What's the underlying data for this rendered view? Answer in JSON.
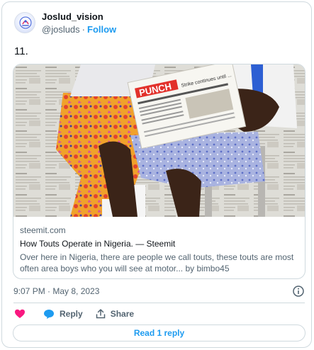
{
  "author": {
    "display_name": "Joslud_vision",
    "handle": "@josluds",
    "separator": "·",
    "follow_label": "Follow"
  },
  "tweet": {
    "text": "11."
  },
  "link_card": {
    "domain": "steemit.com",
    "title": "How Touts Operate in Nigeria. — Steemit",
    "description": "Over here in Nigeria, there are people we call touts, these touts are most often area boys who you will see at motor... by bimbo45",
    "image_alt_icon": "newspaper-reader-photo",
    "image_newspaper_masthead": "PUNCH",
    "image_newspaper_headline": "Strike continues until ..."
  },
  "meta": {
    "timestamp": "9:07 PM · May 8, 2023",
    "info_icon": "info-icon"
  },
  "actions": {
    "like_icon": "heart-icon",
    "reply_label": "Reply",
    "reply_icon": "reply-bubble-icon",
    "share_label": "Share",
    "share_icon": "share-upload-icon"
  },
  "replies": {
    "read_label": "Read 1 reply"
  },
  "colors": {
    "accent": "#1d9bf0",
    "like": "#f91880",
    "text": "#0f1419",
    "muted": "#536471",
    "border": "#cfd9de"
  }
}
